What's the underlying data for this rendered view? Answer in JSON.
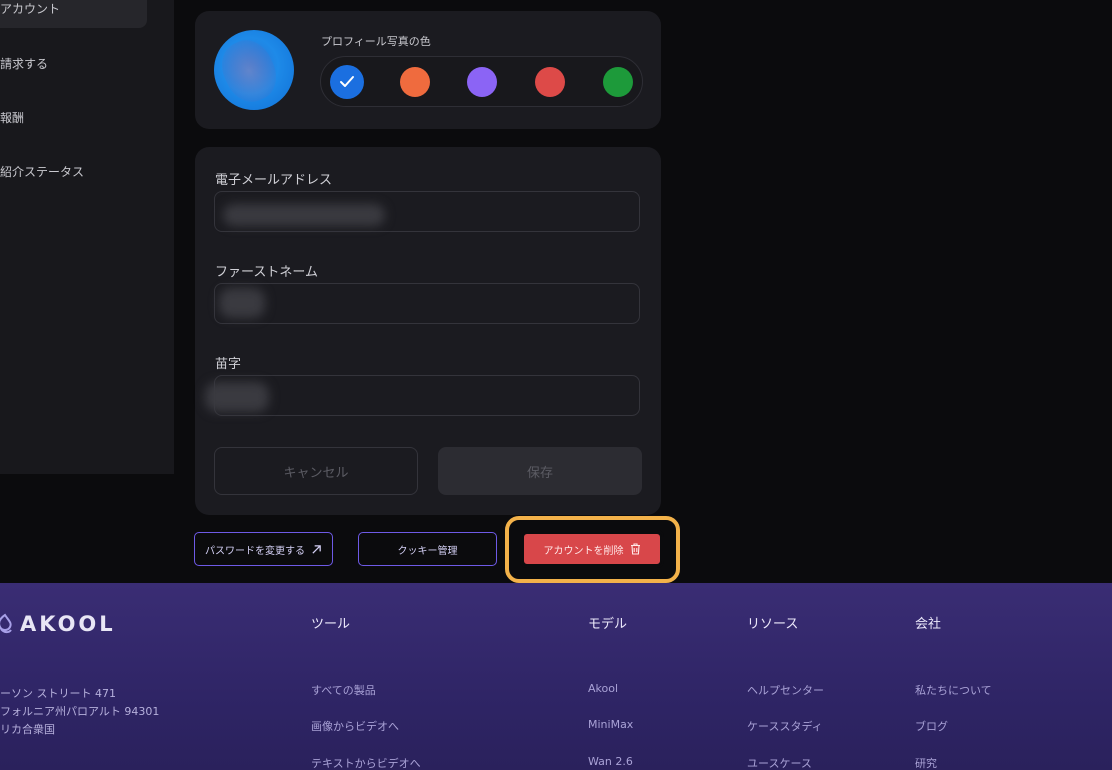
{
  "sidebar": {
    "items": [
      {
        "label": "アカウント"
      },
      {
        "label": "請求する"
      },
      {
        "label": "報酬"
      },
      {
        "label": "紹介ステータス"
      }
    ]
  },
  "profile": {
    "color_label": "プロフィール写真の色",
    "swatches": [
      "#1b6fe0",
      "#ef6b3e",
      "#8b64f5",
      "#dd4a48",
      "#1d9a3a"
    ],
    "selected_index": 0
  },
  "form": {
    "email_label": "電子メールアドレス",
    "first_name_label": "ファーストネーム",
    "last_name_label": "苗字",
    "cancel_label": "キャンセル",
    "save_label": "保存"
  },
  "actions": {
    "change_password": "パスワードを変更する",
    "cookie_manage": "クッキー管理",
    "delete_account": "アカウントを削除"
  },
  "footer": {
    "brand": "AKOOL",
    "address": [
      "ーソン ストリート 471",
      "フォルニア州パロアルト 94301",
      "リカ合衆国"
    ],
    "columns": [
      {
        "title": "ツール",
        "links": [
          "すべての製品",
          "画像からビデオへ",
          "テキストからビデオへ"
        ]
      },
      {
        "title": "モデル",
        "links": [
          "Akool",
          "MiniMax",
          "Wan 2.6"
        ]
      },
      {
        "title": "リソース",
        "links": [
          "ヘルプセンター",
          "ケーススタディ",
          "ユースケース"
        ]
      },
      {
        "title": "会社",
        "links": [
          "私たちについて",
          "ブログ",
          "研究"
        ]
      }
    ]
  }
}
